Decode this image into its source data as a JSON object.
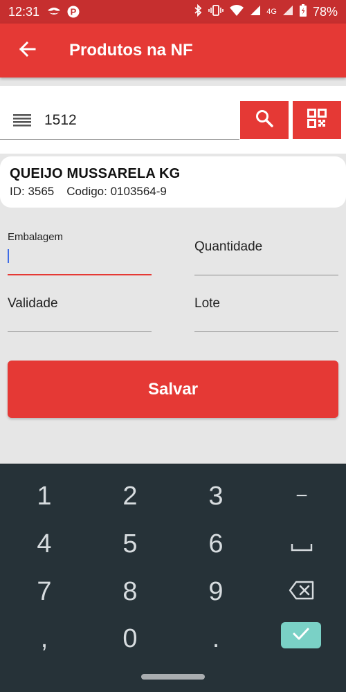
{
  "status": {
    "time": "12:31",
    "network": "4G",
    "battery": "78%"
  },
  "appbar": {
    "title": "Produtos na NF",
    "back_icon": "arrow-left-icon"
  },
  "search": {
    "value": "1512",
    "menu_icon": "barcode-menu-icon",
    "search_icon": "search-icon",
    "qr_icon": "qr-code-icon"
  },
  "product": {
    "name": "QUEIJO MUSSARELA KG",
    "id_text": "ID: 3565",
    "code_text": "Codigo: 0103564-9"
  },
  "form": {
    "embalagem_label": "Embalagem",
    "quantidade_label": "Quantidade",
    "validade_label": "Validade",
    "lote_label": "Lote",
    "save_label": "Salvar"
  },
  "keyboard": {
    "k1": "1",
    "k2": "2",
    "k3": "3",
    "minus": "−",
    "k4": "4",
    "k5": "5",
    "k6": "6",
    "k7": "7",
    "k8": "8",
    "k9": "9",
    "comma": ",",
    "k0": "0",
    "dot": "."
  },
  "colors": {
    "accent": "#e53935",
    "statusbar": "#c62f2f",
    "keyboard_bg": "#263238",
    "ok_key": "#7ad1c6"
  }
}
